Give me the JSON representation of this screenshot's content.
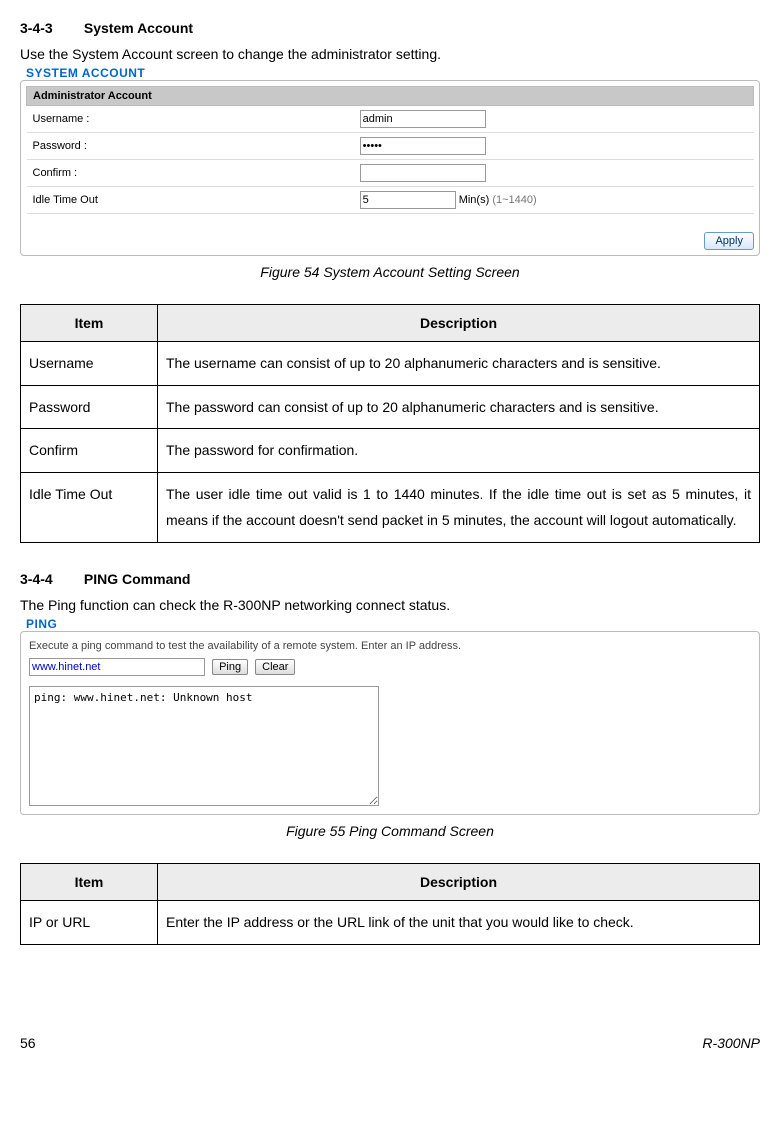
{
  "section1": {
    "number": "3-4-3",
    "title": "System Account",
    "intro": "Use the System Account screen to change the administrator setting.",
    "panel_title": "SYSTEM ACCOUNT",
    "account_header": "Administrator Account",
    "rows": {
      "username": {
        "label": "Username :",
        "value": "admin"
      },
      "password": {
        "label": "Password :",
        "value": "•••••"
      },
      "confirm": {
        "label": "Confirm :",
        "value": ""
      },
      "idle": {
        "label": "Idle Time Out",
        "value": "5",
        "suffix_unit": "Min(s)",
        "suffix_range": "(1~1440)"
      }
    },
    "apply": "Apply",
    "figcap": "Figure 54 System Account Setting Screen"
  },
  "table1": {
    "headers": {
      "item": "Item",
      "desc": "Description"
    },
    "rows": [
      {
        "item": "Username",
        "desc": "The username can consist of up to 20 alphanumeric characters and is sensitive."
      },
      {
        "item": "Password",
        "desc": "The password can consist of up to 20 alphanumeric characters and is sensitive."
      },
      {
        "item": "Confirm",
        "desc": "The password for confirmation."
      },
      {
        "item": "Idle Time Out",
        "desc": "The user idle time out valid is 1 to 1440 minutes. If the idle time out is set as 5 minutes, it means if the account doesn't send packet in 5 minutes, the account will logout automatically."
      }
    ]
  },
  "section2": {
    "number": "3-4-4",
    "title": "PING Command",
    "intro": "The Ping function can check the R-300NP networking connect status.",
    "panel_title": "PING",
    "instruction": "Execute a ping command to test the availability of a remote system. Enter an IP address.",
    "host_value": "www.hinet.net",
    "ping_btn": "Ping",
    "clear_btn": "Clear",
    "output": "ping: www.hinet.net: Unknown host",
    "figcap": "Figure 55 Ping Command Screen"
  },
  "table2": {
    "headers": {
      "item": "Item",
      "desc": "Description"
    },
    "rows": [
      {
        "item": "IP or URL",
        "desc": "Enter the IP address or the URL link of the unit that you would like to check."
      }
    ]
  },
  "footer": {
    "page": "56",
    "model": "R-300NP"
  }
}
